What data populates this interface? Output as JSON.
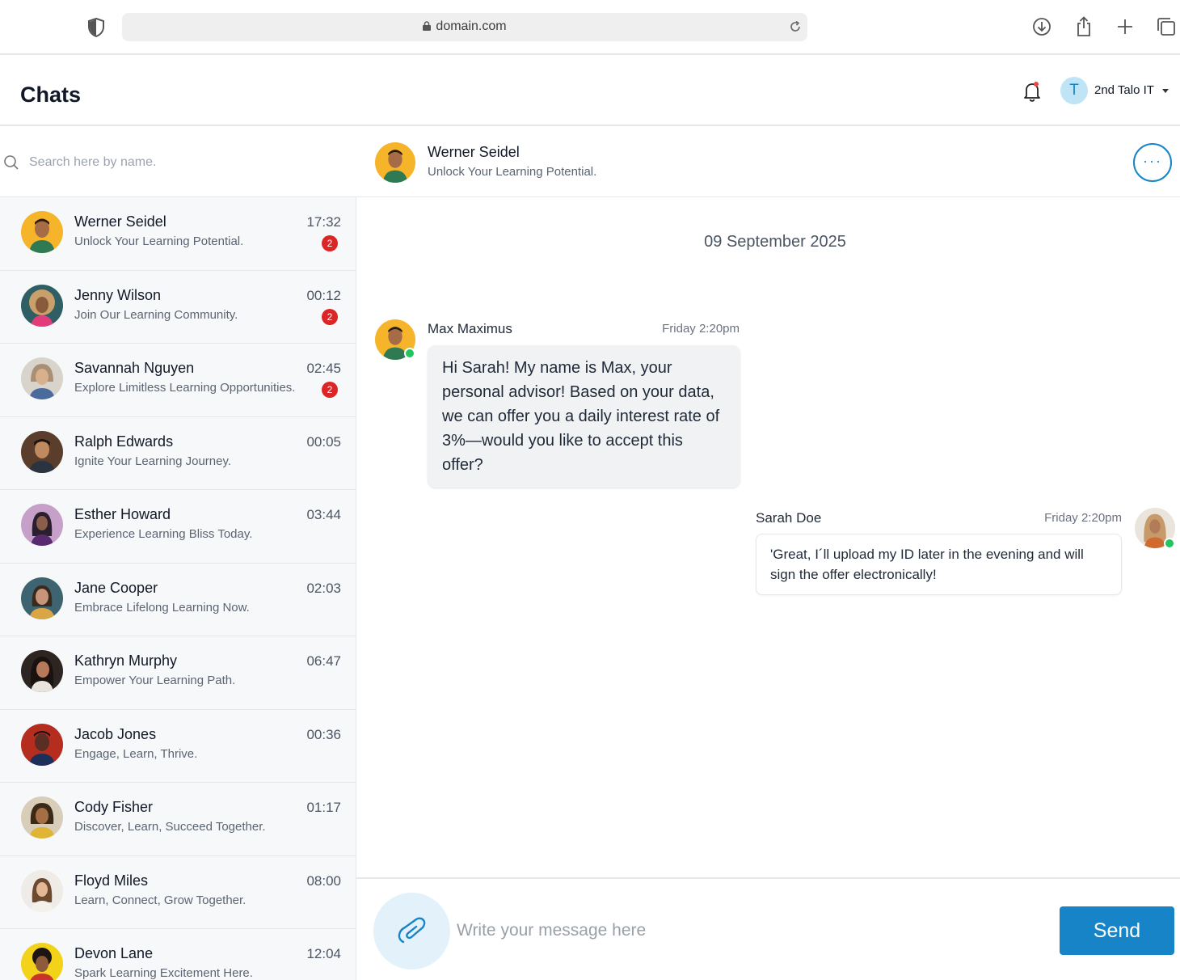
{
  "browser": {
    "url": "domain.com",
    "icons": [
      "shield-icon",
      "lock-icon",
      "reload-icon",
      "download-icon",
      "share-icon",
      "new-tab-icon",
      "tabs-icon"
    ]
  },
  "header": {
    "title": "Chats",
    "account": {
      "initial": "T",
      "name": "2nd Talo IT"
    },
    "colors": {
      "accent": "#1784c7",
      "badge": "#dc2626",
      "online": "#22c55e"
    }
  },
  "search": {
    "placeholder": "Search here by name."
  },
  "chats": [
    {
      "name": "Werner Seidel",
      "preview": "Unlock Your Learning Potential.",
      "time": "17:32",
      "unread": "2"
    },
    {
      "name": "Jenny Wilson",
      "preview": "Join Our Learning Community.",
      "time": "00:12",
      "unread": "2"
    },
    {
      "name": "Savannah Nguyen",
      "preview": "Explore Limitless Learning Opportunities.",
      "time": "02:45",
      "unread": "2"
    },
    {
      "name": "Ralph Edwards",
      "preview": "Ignite Your Learning Journey.",
      "time": "00:05",
      "unread": ""
    },
    {
      "name": "Esther Howard",
      "preview": "Experience Learning Bliss Today.",
      "time": "03:44",
      "unread": ""
    },
    {
      "name": "Jane Cooper",
      "preview": "Embrace Lifelong Learning Now.",
      "time": "02:03",
      "unread": ""
    },
    {
      "name": "Kathryn Murphy",
      "preview": "Empower Your Learning Path.",
      "time": "06:47",
      "unread": ""
    },
    {
      "name": "Jacob Jones",
      "preview": "Engage, Learn, Thrive.",
      "time": "00:36",
      "unread": ""
    },
    {
      "name": "Cody Fisher",
      "preview": "Discover, Learn, Succeed Together.",
      "time": "01:17",
      "unread": ""
    },
    {
      "name": "Floyd Miles",
      "preview": "Learn, Connect, Grow Together.",
      "time": "08:00",
      "unread": ""
    },
    {
      "name": "Devon Lane",
      "preview": "Spark Learning Excitement Here.",
      "time": "12:04",
      "unread": ""
    }
  ],
  "conversation": {
    "name": "Werner Seidel",
    "status": "Unlock Your Learning Potential.",
    "date": "09 September 2025",
    "messages": [
      {
        "sender": "Max Maximus",
        "time": "Friday 2:20pm",
        "text": "Hi Sarah! My name is Max, your personal advisor! Based on your data, we can offer you a daily interest rate of 3%—would you like to accept this offer?"
      },
      {
        "sender": "Sarah Doe",
        "time": "Friday 2:20pm",
        "text": "'Great, I´ll upload my ID later in the evening and will sign the offer electronically!"
      }
    ]
  },
  "composer": {
    "placeholder": "Write your message here",
    "send_label": "Send"
  }
}
